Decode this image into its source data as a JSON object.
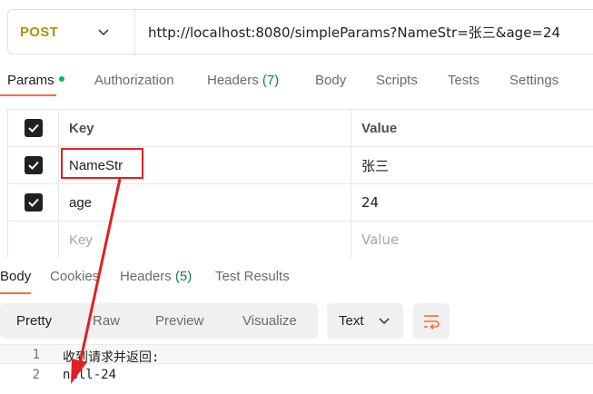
{
  "request": {
    "method": "POST",
    "url": "http://localhost:8080/simpleParams?NameStr=张三&age=24"
  },
  "request_tabs": [
    {
      "label": "Params",
      "active": true
    },
    {
      "label": "Authorization"
    },
    {
      "label": "Headers",
      "count": "(7)"
    },
    {
      "label": "Body"
    },
    {
      "label": "Scripts"
    },
    {
      "label": "Tests"
    },
    {
      "label": "Settings"
    }
  ],
  "params_table": {
    "headers": {
      "key": "Key",
      "value": "Value"
    },
    "rows": [
      {
        "checked": true,
        "key": "NameStr",
        "value": "张三"
      },
      {
        "checked": true,
        "key": "age",
        "value": "24"
      }
    ],
    "placeholder": {
      "key": "Key",
      "value": "Value"
    }
  },
  "response_tabs": [
    {
      "label": "Body",
      "active": true
    },
    {
      "label": "Cookies"
    },
    {
      "label": "Headers",
      "count": "(5)"
    },
    {
      "label": "Test Results"
    }
  ],
  "response_views": [
    "Pretty",
    "Raw",
    "Preview",
    "Visualize"
  ],
  "response_format": "Text",
  "response_body": [
    {
      "line": "1",
      "text": "收到请求并返回:"
    },
    {
      "line": "2",
      "text": "null-24"
    }
  ],
  "colors": {
    "method": "#b58e00",
    "active_tab_underline": "#ff6c37",
    "count": "#0a8a3a",
    "annotation": "#e02020",
    "wrap_icon": "#ff6c37"
  }
}
